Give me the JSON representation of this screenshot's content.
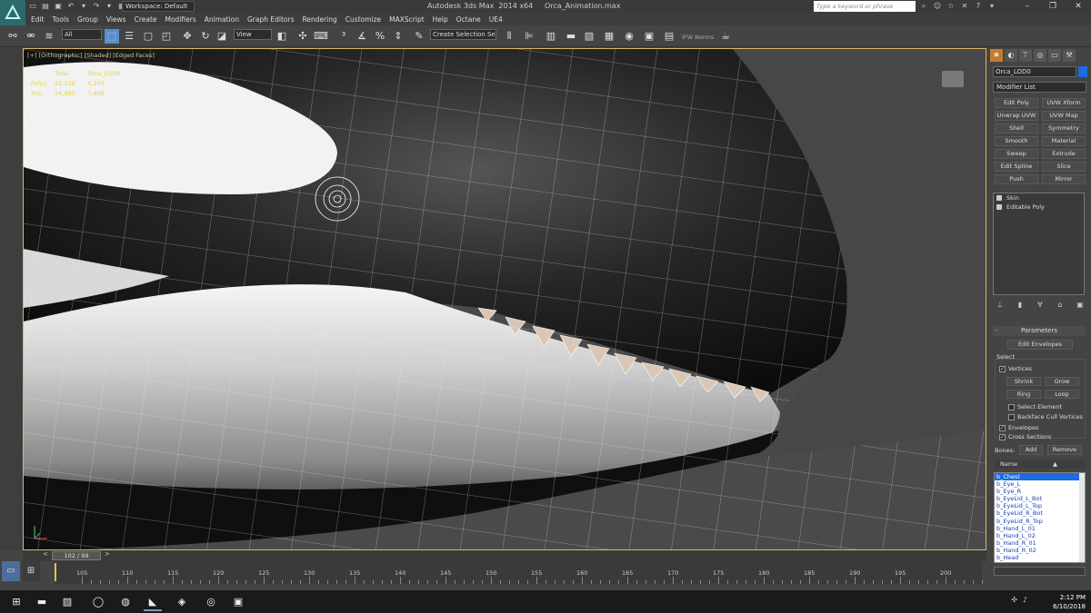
{
  "window": {
    "title": "Autodesk 3ds Max  2014 x64     Orca_Animation.max",
    "workspace": "Workspace: Default",
    "search_placeholder": "Type a keyword or phrase"
  },
  "menu": [
    "Edit",
    "Tools",
    "Group",
    "Views",
    "Create",
    "Modifiers",
    "Animation",
    "Graph Editors",
    "Rendering",
    "Customize",
    "MAXScript",
    "Help",
    "Octane",
    "UE4"
  ],
  "toolbar": {
    "filter_select": "All",
    "ref_coord": "View",
    "selection_set": "Create Selection Se",
    "ifw_label": "IFW Norms"
  },
  "viewport": {
    "label": "[+] [Orthographic] [Shaded] [Edged Faces]",
    "stats_header": [
      "Total",
      "Orca_LOD0"
    ],
    "stats": [
      {
        "name": "Polys:",
        "total": "22,158",
        "sel": "4,203"
      },
      {
        "name": "Tris:",
        "total": "34,980",
        "sel": "7,806"
      }
    ]
  },
  "command_panel": {
    "object_name": "Orca_LOD0",
    "object_color": "#1a6ce0",
    "modifier_list": "Modifier List",
    "modifier_buttons": [
      "Edit Poly",
      "UVW Xform",
      "Unwrap UVW",
      "UVW Map",
      "Shell",
      "Symmetry",
      "Smooth",
      "Material",
      "Sweep",
      "Extrude",
      "Edit Spline",
      "Slice",
      "Push",
      "Mirror"
    ],
    "stack": [
      "Skin",
      "Editable Poly"
    ],
    "parameters": {
      "title": "Parameters",
      "edit_envelopes": "Edit Envelopes",
      "select_label": "Select",
      "vertices": "Vertices",
      "shrink": "Shrink",
      "grow": "Grow",
      "ring": "Ring",
      "loop": "Loop",
      "select_element": "Select Element",
      "backface": "Backface Cull Vertices",
      "envelopes": "Envelopes",
      "cross_sections": "Cross Sections",
      "bones_label": "Bones:",
      "add": "Add",
      "remove": "Remove",
      "name_col": "Name"
    },
    "bones": [
      "b_Chest",
      "b_Eye_L",
      "b_Eye_R",
      "b_EyeLid_L_Bot",
      "b_EyeLid_L_Top",
      "b_EyeLid_R_Bot",
      "b_EyeLid_R_Top",
      "b_Hand_L_01",
      "b_Hand_L_02",
      "b_Hand_R_01",
      "b_Hand_R_02",
      "b_Head"
    ]
  },
  "timeline": {
    "frame": "102 / 99",
    "ticks": [
      "105",
      "110",
      "115",
      "120",
      "125",
      "130",
      "135",
      "140",
      "145",
      "150",
      "155",
      "160",
      "165",
      "170",
      "175",
      "180",
      "185",
      "190",
      "195",
      "200"
    ]
  },
  "taskbar": {
    "time": "2:12 PM",
    "date": "6/10/2018"
  }
}
